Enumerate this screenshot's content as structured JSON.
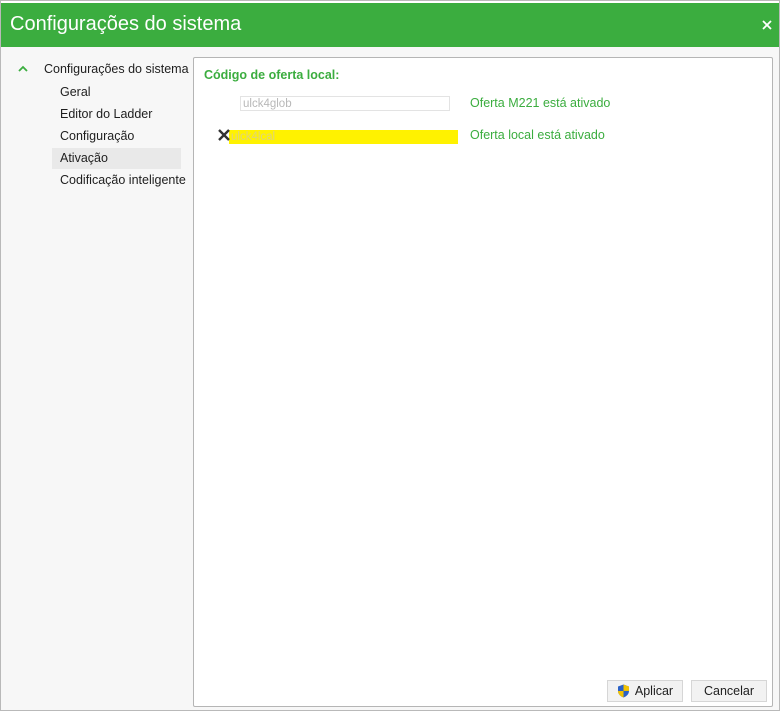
{
  "window": {
    "title": "Configurações do sistema"
  },
  "colors": {
    "accent": "#3bad3f",
    "highlight": "#fff200"
  },
  "sidebar": {
    "root_label": "Configurações do sistema",
    "items": [
      {
        "label": "Geral",
        "selected": false
      },
      {
        "label": "Editor do Ladder",
        "selected": false
      },
      {
        "label": "Configuração",
        "selected": false
      },
      {
        "label": "Ativação",
        "selected": true
      },
      {
        "label": "Codificação inteligente",
        "selected": false
      }
    ]
  },
  "activation": {
    "section_title": "Código de oferta local:",
    "offers": [
      {
        "code": "ulck4glob",
        "status": "Oferta M221 está ativado"
      },
      {
        "code": "ulck4lcal",
        "status": "Oferta local está ativado"
      }
    ]
  },
  "buttons": {
    "apply_label": "Aplicar",
    "cancel_label": "Cancelar"
  },
  "icons": {
    "close": "close-icon",
    "collapse": "chevron-up-icon",
    "remove": "remove-x-icon",
    "uac_shield": "uac-shield-icon"
  }
}
